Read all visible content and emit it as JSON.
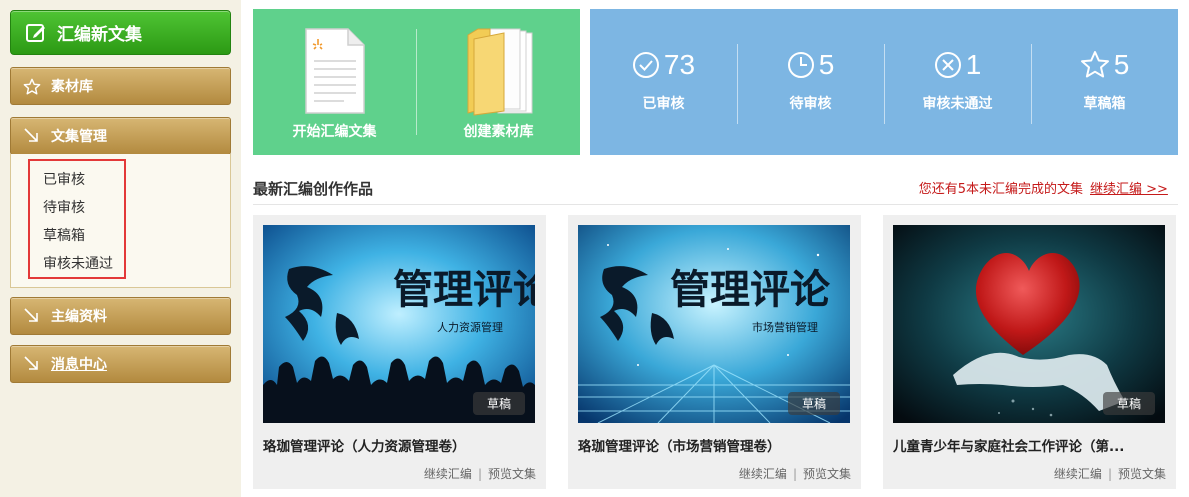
{
  "sidebar": {
    "new_button": "汇编新文集",
    "material_library": "素材库",
    "collection_management": "文集管理",
    "submenu": [
      "已审核",
      "待审核",
      "草稿箱",
      "审核未通过"
    ],
    "chief_editor_info": "主编资料",
    "message_center": "消息中心"
  },
  "actions": {
    "start_compile": "开始汇编文集",
    "create_library": "创建素材库"
  },
  "stats": [
    {
      "icon": "check-circle-icon",
      "count": "73",
      "label": "已审核"
    },
    {
      "icon": "clock-icon",
      "count": "5",
      "label": "待审核"
    },
    {
      "icon": "x-circle-icon",
      "count": "1",
      "label": "审核未通过"
    },
    {
      "icon": "star-icon",
      "count": "5",
      "label": "草稿箱"
    }
  ],
  "section": {
    "title": "最新汇编创作作品",
    "notice": "您还有5本未汇编完成的文集",
    "continue_link": "继续汇编 >>"
  },
  "cards": [
    {
      "cover_title": "管理评论",
      "cover_subtitle": "人力资源管理",
      "badge": "草稿",
      "title": "珞珈管理评论（人力资源管理卷）",
      "action_continue": "继续汇编",
      "action_preview": "预览文集"
    },
    {
      "cover_title": "管理评论",
      "cover_subtitle": "市场营销管理",
      "badge": "草稿",
      "title": "珞珈管理评论（市场营销管理卷）",
      "action_continue": "继续汇编",
      "action_preview": "预览文集"
    },
    {
      "cover_title": "",
      "cover_subtitle": "",
      "badge": "草稿",
      "title": "儿童青少年与家庭社会工作评论（第...",
      "action_continue": "继续汇编",
      "action_preview": "预览文集"
    }
  ],
  "colors": {
    "green_panel": "#5fd18c",
    "blue_panel": "#7db6e3",
    "sidebar_gold": "#c49e55",
    "new_button_green": "#3bb01f",
    "notice_red": "#c51a1a",
    "highlight_box": "#e33939"
  }
}
